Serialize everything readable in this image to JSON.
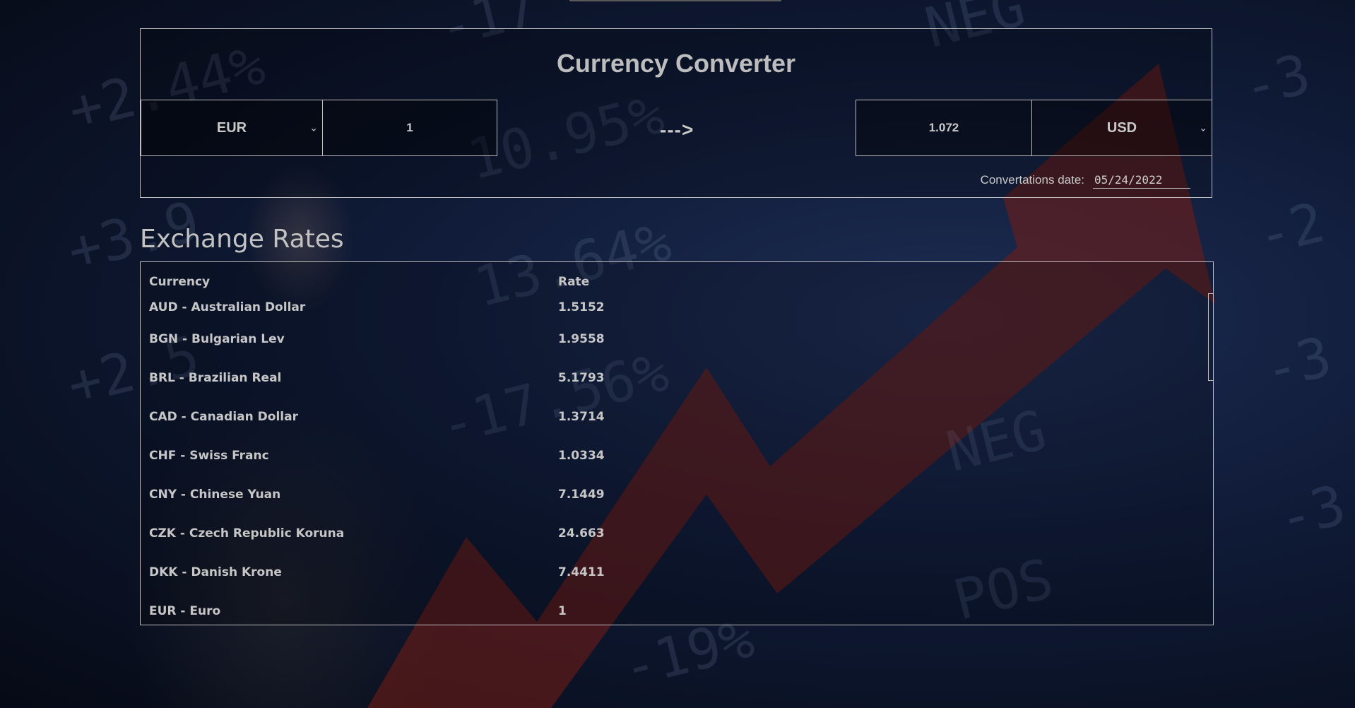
{
  "converter": {
    "title": "Currency Converter",
    "from_currency": "EUR",
    "from_amount": "1",
    "arrow": "--->",
    "to_amount": "1.072",
    "to_currency": "USD",
    "date_label": "Convertations date:",
    "date_value": "05/24/2022"
  },
  "background_numbers": [
    "+2.44%",
    "10.95%",
    "-17",
    "NEG",
    "+3.9",
    "13.64%",
    "+2.5",
    "-17.56%",
    "-3",
    "-2",
    "-3",
    "-3",
    "NEG",
    "POS",
    "-19%"
  ],
  "rates": {
    "heading": "Exchange Rates",
    "columns": [
      "Currency",
      "Rate"
    ],
    "rows": [
      {
        "currency": "AUD - Australian Dollar",
        "rate": "1.5152"
      },
      {
        "currency": "BGN - Bulgarian Lev",
        "rate": "1.9558"
      },
      {
        "currency": "BRL - Brazilian Real",
        "rate": "5.1793"
      },
      {
        "currency": "CAD - Canadian Dollar",
        "rate": "1.3714"
      },
      {
        "currency": "CHF - Swiss Franc",
        "rate": "1.0334"
      },
      {
        "currency": "CNY - Chinese Yuan",
        "rate": "7.1449"
      },
      {
        "currency": "CZK - Czech Republic Koruna",
        "rate": "24.663"
      },
      {
        "currency": "DKK - Danish Krone",
        "rate": "7.4411"
      },
      {
        "currency": "EUR - Euro",
        "rate": "1"
      }
    ]
  },
  "icons": {
    "dropdown": "chevron-down-icon"
  }
}
